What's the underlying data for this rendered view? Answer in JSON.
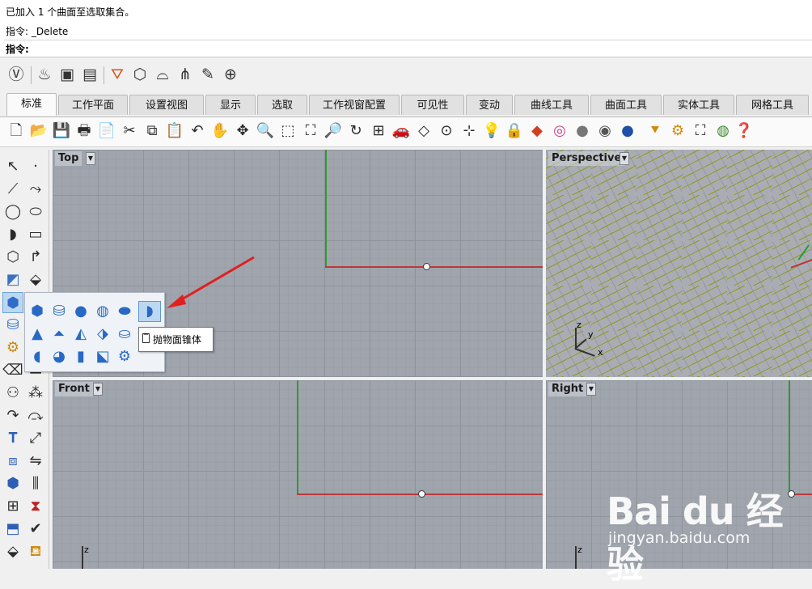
{
  "command_history": {
    "line1": "已加入 1 个曲面至选取集合。",
    "line2": "指令: _Delete",
    "prompt_label": "指令:"
  },
  "tabs": [
    {
      "label": "标准",
      "active": true
    },
    {
      "label": "工作平面"
    },
    {
      "label": "设置视图"
    },
    {
      "label": "显示"
    },
    {
      "label": "选取"
    },
    {
      "label": "工作视窗配置"
    },
    {
      "label": "可见性"
    },
    {
      "label": "变动"
    },
    {
      "label": "曲线工具"
    },
    {
      "label": "曲面工具"
    },
    {
      "label": "实体工具"
    },
    {
      "label": "网格工具"
    }
  ],
  "viewports": {
    "top": {
      "label": "Top"
    },
    "perspective": {
      "label": "Perspective"
    },
    "front": {
      "label": "Front"
    },
    "right": {
      "label": "Right"
    }
  },
  "axis_labels": {
    "x": "x",
    "y": "y",
    "z": "z"
  },
  "tooltip": {
    "text": "抛物面锥体"
  },
  "watermark": {
    "brand": "Bai du 经验",
    "url": "jingyan.baidu.com"
  },
  "colors": {
    "x_axis": "#b93a3a",
    "y_axis": "#2d9a33",
    "selected": "#bcd7f2",
    "arrow": "#e02020"
  }
}
